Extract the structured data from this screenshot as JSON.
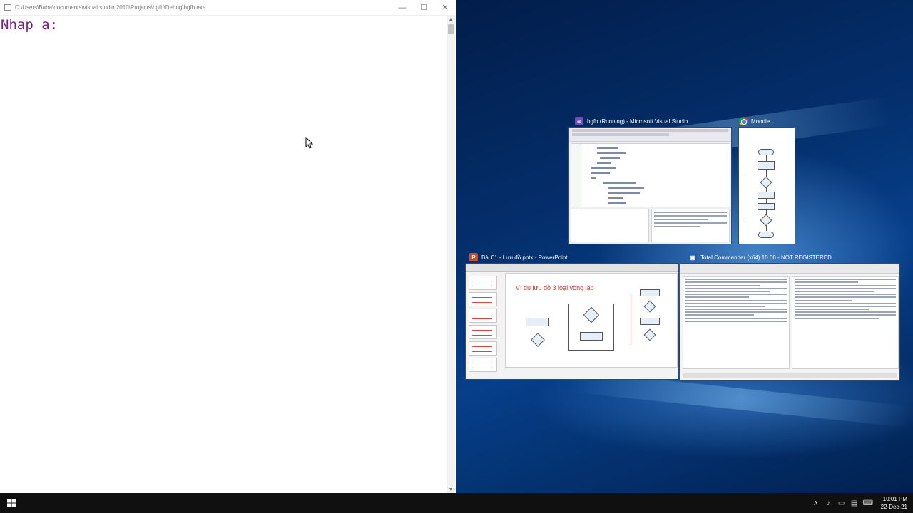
{
  "console_window": {
    "title": "C:\\Users\\Baba\\documents\\visual studio 2010\\Projects\\hgfh\\Debug\\hgfh.exe",
    "output": "Nhap a:",
    "controls": {
      "minimize": "—",
      "maximize": "☐",
      "close": "✕"
    }
  },
  "task_view": {
    "vs": {
      "title": "hgfh (Running) - Microsoft Visual Studio",
      "icon": "visual-studio-icon"
    },
    "moodle": {
      "title": "Moodle...",
      "icon": "chrome-icon"
    },
    "powerpoint": {
      "title": "Bài 01 - Lưu đồ.pptx - PowerPoint",
      "icon": "powerpoint-icon",
      "slide_title": "Ví dụ lưu đồ 3 loại vòng lặp"
    },
    "total_commander": {
      "title": "Total Commander (x64) 10.00 - NOT REGISTERED",
      "icon": "total-commander-icon"
    }
  },
  "taskbar": {
    "time": "10:01 PM",
    "date": "22-Dec-21"
  }
}
